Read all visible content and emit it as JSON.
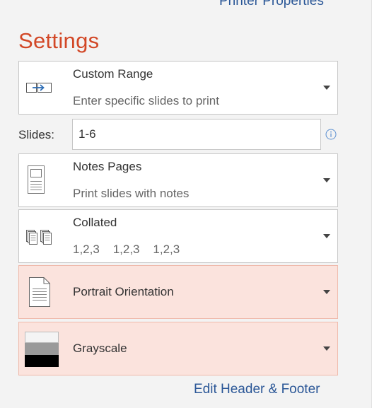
{
  "header": {
    "printer_properties_link": "Printer Properties"
  },
  "settings": {
    "title": "Settings",
    "print_range": {
      "label": "Custom Range",
      "description": "Enter specific slides to print",
      "icon": "custom-range-icon"
    },
    "slides": {
      "label": "Slides:",
      "value": "1-6",
      "info_icon": "info-icon"
    },
    "layout": {
      "label": "Notes Pages",
      "description": "Print slides with notes",
      "icon": "notes-page-icon"
    },
    "collation": {
      "label": "Collated",
      "description": "1,2,3    1,2,3    1,2,3",
      "icon": "collated-icon"
    },
    "orientation": {
      "label": "Portrait Orientation",
      "icon": "portrait-page-icon"
    },
    "color": {
      "label": "Grayscale",
      "icon": "grayscale-icon"
    }
  },
  "footer": {
    "edit_header_footer_link": "Edit Header & Footer"
  },
  "colors": {
    "accent_title": "#d24726",
    "link": "#2b5797",
    "selected_background": "#fbe3dd",
    "selected_border": "#efb9aa"
  }
}
